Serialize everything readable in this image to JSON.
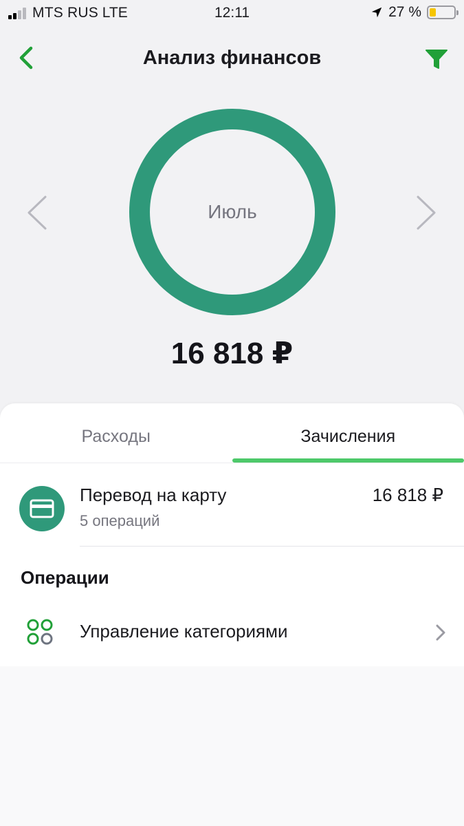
{
  "status_bar": {
    "carrier": "MTS RUS",
    "network": "LTE",
    "time": "12:11",
    "battery_text": "27 %",
    "battery_level": 0.27
  },
  "header": {
    "title": "Анализ финансов",
    "back_icon": "chevron-left-icon",
    "filter_icon": "filter-icon"
  },
  "summary": {
    "month": "Июль",
    "total": "16 818 ₽"
  },
  "chart_data": {
    "type": "pie",
    "categories": [
      "Перевод на карту"
    ],
    "values": [
      16818
    ],
    "colors": [
      "#2f997a"
    ]
  },
  "tabs": [
    {
      "label": "Расходы",
      "active": false
    },
    {
      "label": "Зачисления",
      "active": true
    }
  ],
  "categories": [
    {
      "title": "Перевод на карту",
      "subtitle": "5 операций",
      "amount": "16 818 ₽",
      "icon": "card-icon",
      "color": "#2f997a"
    }
  ],
  "operations": {
    "section_title": "Операции",
    "manage_label": "Управление категориями",
    "manage_icon": "categories-grid-icon"
  },
  "colors": {
    "accent_green": "#4dc96a",
    "donut_green": "#2f997a",
    "header_icon_green": "#21a038"
  }
}
